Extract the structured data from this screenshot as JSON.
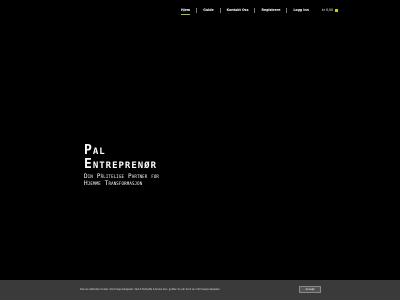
{
  "nav": {
    "items": [
      {
        "label": "Hjem",
        "active": true
      },
      {
        "label": "Guide"
      },
      {
        "label": "Kontakt Oss"
      },
      {
        "label": "Registrere"
      },
      {
        "label": "Logg inn"
      }
    ],
    "cart_amount": "kr 0,00",
    "cart_icon": "shopping-cart-icon",
    "active_underline_color": "#9acd32"
  },
  "hero": {
    "title_line1": "Pal",
    "title_line2": "Entreprenør",
    "subtitle_line1": "Din Pålitelige Partner for",
    "subtitle_line2": "Hjemme Transformasjon"
  },
  "cookie": {
    "text": "Denne nettsiden bruker informasjonskapsler. Ved å fortsette å bruke den, godtar du vår bruk av informasjonskapsler.",
    "accept_label": "Accept"
  }
}
